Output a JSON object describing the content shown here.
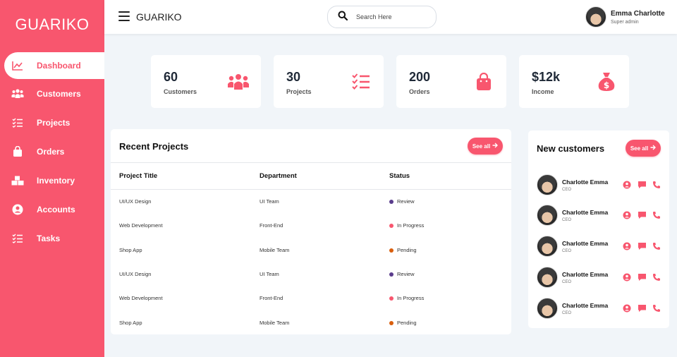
{
  "brand": "GUARIKO",
  "colors": {
    "accent": "#f8566e",
    "background": "#f1f5f9",
    "review": "#5a3c8c",
    "in_progress": "#f8566e",
    "pending": "#d95f0e"
  },
  "sidebar": {
    "items": [
      {
        "label": "Dashboard",
        "icon": "chart-line-icon",
        "active": true
      },
      {
        "label": "Customers",
        "icon": "users-icon"
      },
      {
        "label": "Projects",
        "icon": "checklist-icon"
      },
      {
        "label": "Orders",
        "icon": "shopping-bag-icon"
      },
      {
        "label": "Inventory",
        "icon": "boxes-icon"
      },
      {
        "label": "Accounts",
        "icon": "user-circle-icon"
      },
      {
        "label": "Tasks",
        "icon": "checklist-icon"
      }
    ]
  },
  "topbar": {
    "title": "GUARIKO",
    "search_placeholder": "Search Here",
    "user": {
      "name": "Emma Charlotte",
      "role": "Super admin"
    }
  },
  "stats": [
    {
      "value": "60",
      "label": "Customers",
      "icon": "users-icon"
    },
    {
      "value": "30",
      "label": "Projects",
      "icon": "checklist-icon"
    },
    {
      "value": "200",
      "label": "Orders",
      "icon": "shopping-bag-icon"
    },
    {
      "value": "$12k",
      "label": "Income",
      "icon": "money-bag-icon"
    }
  ],
  "recent_projects": {
    "title": "Recent Projects",
    "see_all": "See all",
    "columns": [
      "Project Title",
      "Department",
      "Status"
    ],
    "rows": [
      {
        "title": "UI/UX Design",
        "department": "UI Team",
        "status": "Review",
        "status_color": "#5a3c8c"
      },
      {
        "title": "Web Development",
        "department": "Front-End",
        "status": "In Progress",
        "status_color": "#f8566e"
      },
      {
        "title": "Shop App",
        "department": "Mobile Team",
        "status": "Pending",
        "status_color": "#d95f0e"
      },
      {
        "title": "UI/UX Design",
        "department": "UI Team",
        "status": "Review",
        "status_color": "#5a3c8c"
      },
      {
        "title": "Web Development",
        "department": "Front-End",
        "status": "In Progress",
        "status_color": "#f8566e"
      },
      {
        "title": "Shop App",
        "department": "Mobile Team",
        "status": "Pending",
        "status_color": "#d95f0e"
      }
    ]
  },
  "new_customers": {
    "title": "New customers",
    "see_all": "See all",
    "items": [
      {
        "name": "Charlotte Emma",
        "role": "CEO"
      },
      {
        "name": "Charlotte Emma",
        "role": "CEO"
      },
      {
        "name": "Charlotte Emma",
        "role": "CEO"
      },
      {
        "name": "Charlotte Emma",
        "role": "CEO"
      },
      {
        "name": "Charlotte Emma",
        "role": "CEO"
      }
    ]
  }
}
